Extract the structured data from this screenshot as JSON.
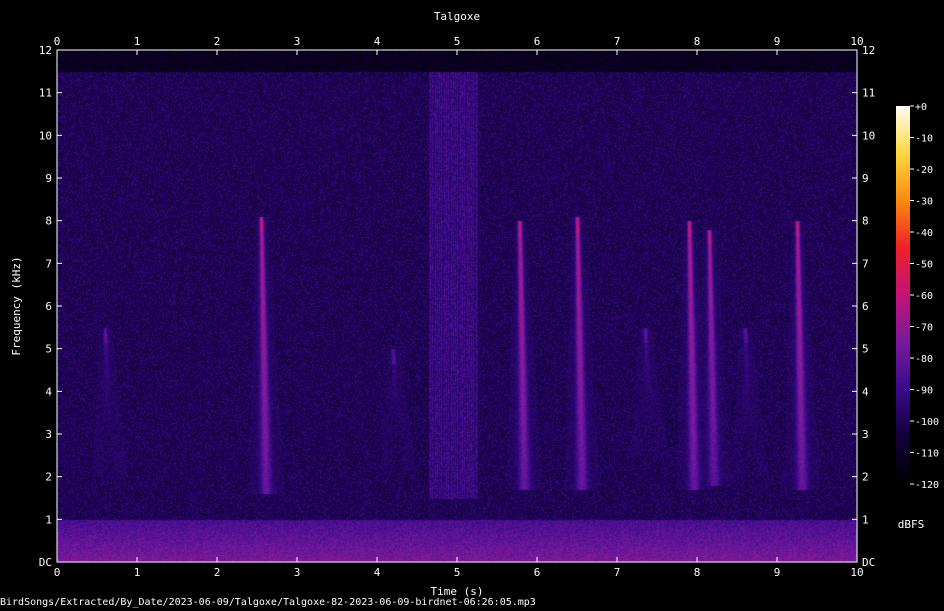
{
  "chart_data": {
    "type": "heatmap",
    "title": "Talgoxe",
    "xlabel": "Time (s)",
    "ylabel": "Frequency (kHz)",
    "xlim": [
      0,
      10
    ],
    "ylim": [
      0,
      12
    ],
    "x_ticks": [
      "0",
      "1",
      "2",
      "3",
      "4",
      "5",
      "6",
      "7",
      "8",
      "9",
      "10"
    ],
    "y_ticks": [
      "DC",
      "1",
      "2",
      "3",
      "4",
      "5",
      "6",
      "7",
      "8",
      "9",
      "10",
      "11",
      "12"
    ],
    "colorbar": {
      "label": "dBFS",
      "range": [
        -120,
        0
      ],
      "ticks": [
        "+0",
        "-10",
        "-20",
        "-30",
        "-40",
        "-50",
        "-60",
        "-70",
        "-80",
        "-90",
        "-100",
        "-110",
        "-120"
      ],
      "colormap": [
        "#000000",
        "#12003a",
        "#3a0a8c",
        "#7a1a9c",
        "#c4137a",
        "#f0202a",
        "#fb8a10",
        "#ffd840",
        "#fffcf0"
      ]
    },
    "background_level_dbfs": -100,
    "low_frequency_band": {
      "f_max_khz": 1.0,
      "level_dbfs": -75
    },
    "events": [
      {
        "type": "broadband_noise",
        "t_start_s": 4.65,
        "t_end_s": 5.25,
        "f_min_khz": 1.5,
        "f_max_khz": 11.5,
        "peak_dbfs": -85
      },
      {
        "type": "call",
        "t_s": 2.55,
        "f_top_khz": 8.1,
        "f_bottom_khz": 1.6,
        "peak_dbfs": -62
      },
      {
        "type": "call",
        "t_s": 5.78,
        "f_top_khz": 8.0,
        "f_bottom_khz": 1.7,
        "peak_dbfs": -62
      },
      {
        "type": "call",
        "t_s": 6.5,
        "f_top_khz": 8.1,
        "f_bottom_khz": 1.7,
        "peak_dbfs": -62
      },
      {
        "type": "call",
        "t_s": 7.9,
        "f_top_khz": 8.0,
        "f_bottom_khz": 1.7,
        "peak_dbfs": -62
      },
      {
        "type": "call",
        "t_s": 8.15,
        "f_top_khz": 7.8,
        "f_bottom_khz": 1.8,
        "peak_dbfs": -65
      },
      {
        "type": "call",
        "t_s": 9.25,
        "f_top_khz": 8.0,
        "f_bottom_khz": 1.7,
        "peak_dbfs": -62
      },
      {
        "type": "faint_call",
        "t_s": 0.6,
        "f_top_khz": 5.5,
        "f_bottom_khz": 2.0,
        "peak_dbfs": -88
      },
      {
        "type": "faint_call",
        "t_s": 4.2,
        "f_top_khz": 5.0,
        "f_bottom_khz": 2.2,
        "peak_dbfs": -90
      },
      {
        "type": "faint_call",
        "t_s": 7.35,
        "f_top_khz": 5.5,
        "f_bottom_khz": 2.5,
        "peak_dbfs": -88
      },
      {
        "type": "faint_call",
        "t_s": 8.6,
        "f_top_khz": 5.5,
        "f_bottom_khz": 2.0,
        "peak_dbfs": -88
      }
    ]
  },
  "footer": {
    "file_path": "BirdSongs/Extracted/By_Date/2023-06-09/Talgoxe/Talgoxe-82-2023-06-09-birdnet-06:26:05.mp3"
  }
}
